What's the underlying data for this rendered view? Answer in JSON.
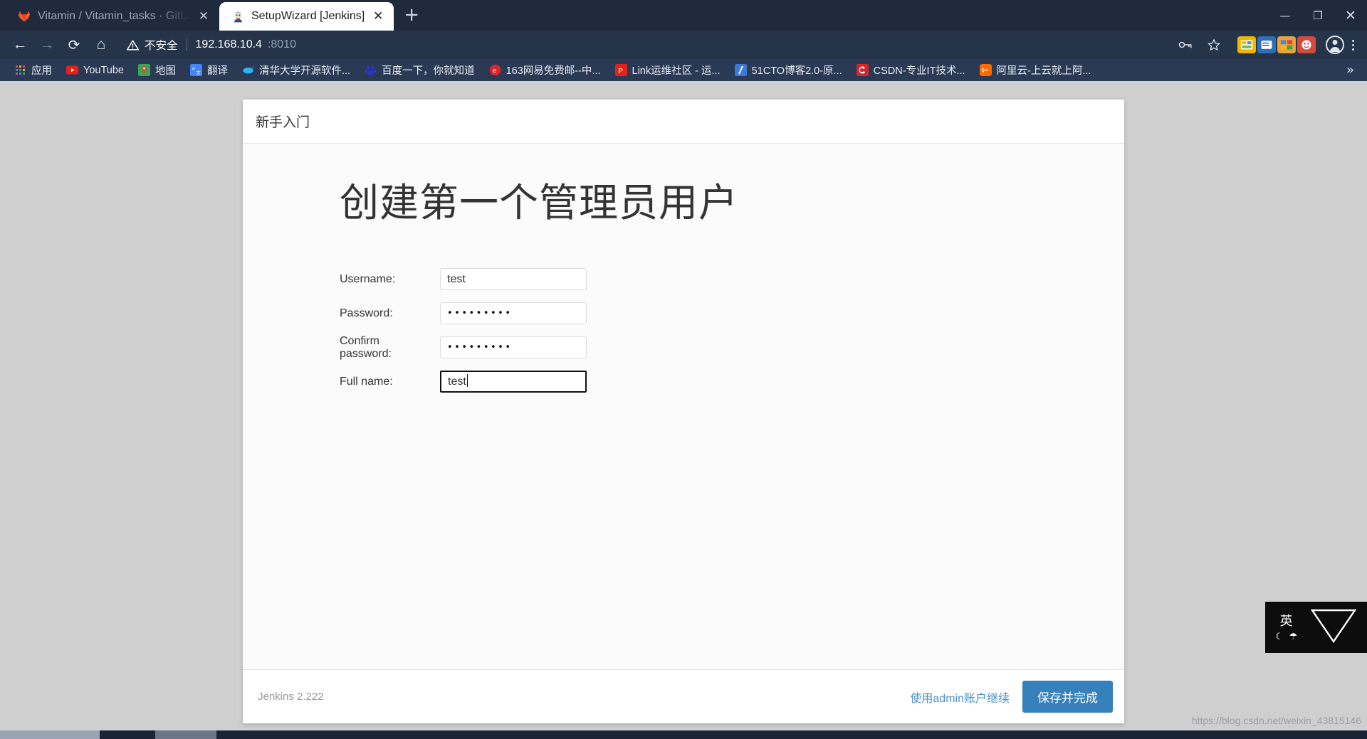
{
  "browser": {
    "tabs": [
      {
        "title": "Vitamin / Vitamin_tasks · GitLab",
        "favicon": "gitlab-icon",
        "active": false,
        "close_label": "✕"
      },
      {
        "title": "SetupWizard [Jenkins]",
        "favicon": "jenkins-icon",
        "active": true,
        "close_label": "✕"
      }
    ],
    "new_tab_label": "+",
    "window_controls": {
      "minimize": "—",
      "maximize": "❐",
      "close": "✕"
    },
    "nav": {
      "back": "←",
      "forward": "→",
      "reload": "⟳",
      "home": "⌂"
    },
    "omnibox": {
      "security_label": "不安全",
      "warning_icon": "warning-triangle-icon",
      "url_host": "192.168.10.4",
      "url_port": ":8010",
      "key_icon": "key-icon",
      "star_icon": "star-icon"
    },
    "extensions": [
      {
        "name": "extension-1",
        "glyph": "▤",
        "color": "#f2b600"
      },
      {
        "name": "extension-2",
        "glyph": "☰",
        "color": "#3a7ec9"
      },
      {
        "name": "extension-3",
        "glyph": "▩",
        "color": "#e8a33d"
      },
      {
        "name": "extension-4",
        "glyph": "●",
        "color": "#d44a3c"
      }
    ],
    "profile_icon": "profile-avatar-icon",
    "menu_icon": "kebab-menu-icon",
    "bookmarks": [
      {
        "label": "应用",
        "icon": "apps-grid-icon",
        "color": "#e84a3f"
      },
      {
        "label": "YouTube",
        "icon": "youtube-icon",
        "color": "#e62117"
      },
      {
        "label": "地图",
        "icon": "maps-pin-icon",
        "color": "#34a853"
      },
      {
        "label": "翻译",
        "icon": "translate-icon",
        "color": "#4285f4"
      },
      {
        "label": "清华大学开源软件...",
        "icon": "tuna-mirror-icon",
        "color": "#29b6f6"
      },
      {
        "label": "百度一下，你就知道",
        "icon": "baidu-icon",
        "color": "#2932e1"
      },
      {
        "label": "163网易免费邮--中...",
        "icon": "netease-mail-icon",
        "color": "#d8262c"
      },
      {
        "label": "Link运维社区 - 运...",
        "icon": "link-community-icon",
        "color": "#e2231a"
      },
      {
        "label": "51CTO博客2.0-原...",
        "icon": "cto51-icon",
        "color": "#2a6fdb"
      },
      {
        "label": "CSDN-专业IT技术...",
        "icon": "csdn-icon",
        "color": "#d6262b"
      },
      {
        "label": "阿里云-上云就上阿...",
        "icon": "aliyun-icon",
        "color": "#ff6a00"
      }
    ],
    "bookmarks_overflow": "»"
  },
  "wizard": {
    "header_title": "新手入门",
    "page_title": "创建第一个管理员用户",
    "fields": [
      {
        "label": "Username:",
        "value": "test",
        "type": "text",
        "focused": false,
        "name": "username"
      },
      {
        "label": "Password:",
        "value": "•••••••••",
        "type": "password",
        "focused": false,
        "name": "password"
      },
      {
        "label": "Confirm password:",
        "value": "•••••••••",
        "type": "password",
        "focused": false,
        "name": "confirm-password"
      },
      {
        "label": "Full name:",
        "value": "test",
        "type": "text",
        "focused": true,
        "name": "full-name"
      }
    ],
    "footer": {
      "version": "Jenkins 2.222",
      "skip_link": "使用admin账户继续",
      "submit_label": "保存并完成",
      "submit_color": "#3680bb"
    }
  },
  "ime": {
    "mode_char": "英",
    "moon_glyph": "☾",
    "shape_glyph": "☂",
    "triangle_icon": "triangle-down-icon"
  },
  "watermark": "https://blog.csdn.net/weixin_43815146"
}
